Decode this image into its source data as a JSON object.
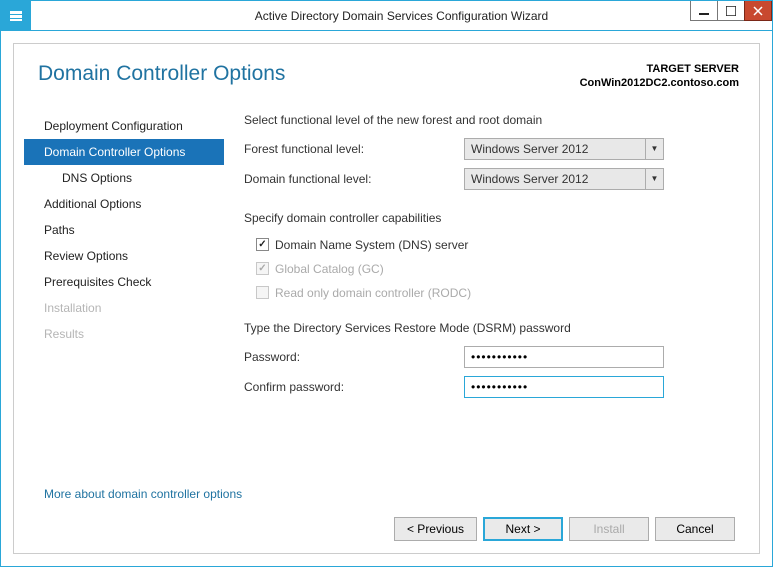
{
  "titlebar": {
    "title": "Active Directory Domain Services Configuration Wizard"
  },
  "header": {
    "page_title": "Domain Controller Options",
    "target_label": "TARGET SERVER",
    "target_server": "ConWin2012DC2.contoso.com"
  },
  "sidebar": {
    "items": [
      {
        "label": "Deployment Configuration",
        "state": "normal"
      },
      {
        "label": "Domain Controller Options",
        "state": "selected"
      },
      {
        "label": "DNS Options",
        "state": "sub"
      },
      {
        "label": "Additional Options",
        "state": "normal"
      },
      {
        "label": "Paths",
        "state": "normal"
      },
      {
        "label": "Review Options",
        "state": "normal"
      },
      {
        "label": "Prerequisites Check",
        "state": "normal"
      },
      {
        "label": "Installation",
        "state": "disabled"
      },
      {
        "label": "Results",
        "state": "disabled"
      }
    ]
  },
  "main": {
    "func_level_heading": "Select functional level of the new forest and root domain",
    "forest_label": "Forest functional level:",
    "forest_value": "Windows Server 2012",
    "domain_label": "Domain functional level:",
    "domain_value": "Windows Server 2012",
    "capabilities_heading": "Specify domain controller capabilities",
    "dns_label": "Domain Name System (DNS) server",
    "gc_label": "Global Catalog (GC)",
    "rodc_label": "Read only domain controller (RODC)",
    "dsrm_heading": "Type the Directory Services Restore Mode (DSRM) password",
    "password_label": "Password:",
    "password_value": "•••••••••••",
    "confirm_label": "Confirm password:",
    "confirm_value": "•••••••••••",
    "more_link": "More about domain controller options"
  },
  "footer": {
    "previous": "< Previous",
    "next": "Next >",
    "install": "Install",
    "cancel": "Cancel"
  }
}
